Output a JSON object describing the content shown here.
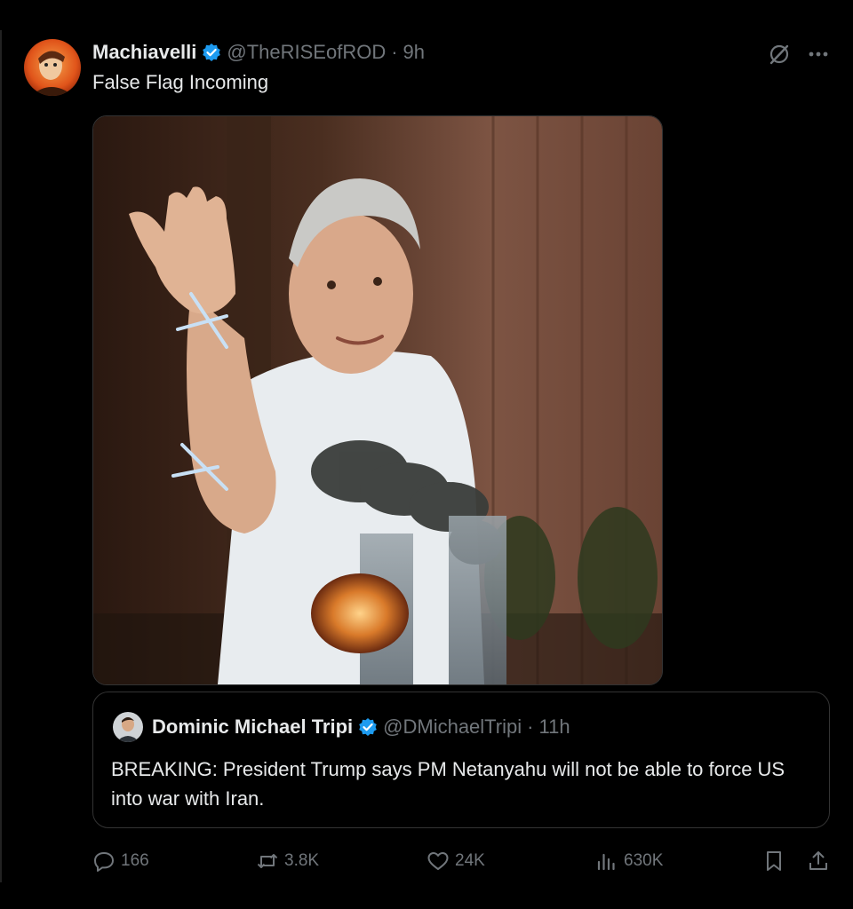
{
  "tweet": {
    "author_name": "Machiavelli",
    "handle": "@TheRISEofROD",
    "separator": "·",
    "time": "9h",
    "text": "False Flag Incoming"
  },
  "quote": {
    "author_name": "Dominic Michael Tripi",
    "handle": "@DMichaelTripi",
    "separator": "·",
    "time": "11h",
    "text": "BREAKING: President Trump says PM Netanyahu will not be able to force US into war with Iran."
  },
  "actions": {
    "replies": "166",
    "reposts": "3.8K",
    "likes": "24K",
    "views": "630K"
  },
  "icons": {
    "verified": "verified-badge-icon",
    "grok": "grok-icon",
    "more": "more-icon",
    "reply": "reply-icon",
    "repost": "repost-icon",
    "like": "like-icon",
    "views": "views-icon",
    "bookmark": "bookmark-icon",
    "share": "share-icon"
  },
  "colors": {
    "background": "#000000",
    "text": "#e7e9ea",
    "muted": "#71767b",
    "verified": "#1d9bf0",
    "border": "#333333"
  }
}
